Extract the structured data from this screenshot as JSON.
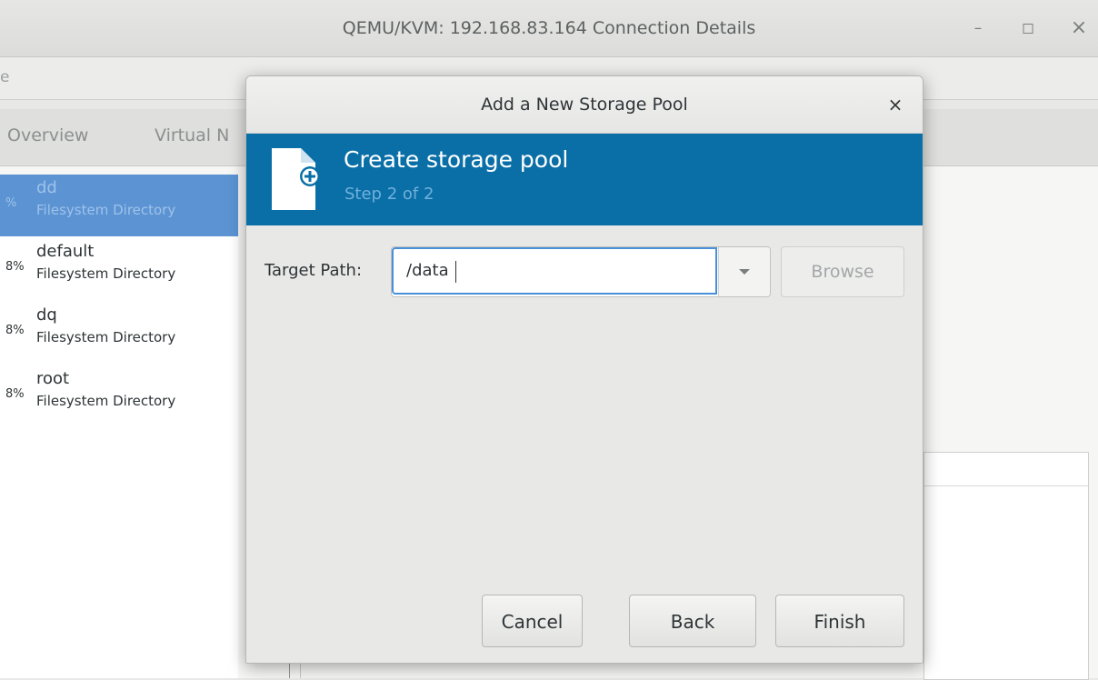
{
  "window": {
    "title": "QEMU/KVM: 192.168.83.164 Connection Details",
    "controls": {
      "minimize": "–",
      "maximize": "◻",
      "close": "×"
    }
  },
  "menubar": {
    "partial_item": "e"
  },
  "tabs": [
    {
      "label": "Overview"
    },
    {
      "label": "Virtual N"
    }
  ],
  "pools": [
    {
      "percent": "%",
      "name": "dd",
      "type": "Filesystem Directory",
      "selected": true
    },
    {
      "percent": "8%",
      "name": "default",
      "type": "Filesystem Directory",
      "selected": false
    },
    {
      "percent": "8%",
      "name": "dq",
      "type": "Filesystem Directory",
      "selected": false
    },
    {
      "percent": "8%",
      "name": "root",
      "type": "Filesystem Directory",
      "selected": false
    }
  ],
  "dialog": {
    "title": "Add a New Storage Pool",
    "close_label": "×",
    "banner": {
      "title": "Create storage pool",
      "step": "Step 2 of 2",
      "icon": "document-add-icon"
    },
    "target_path": {
      "label": "Target Path:",
      "value": "/data",
      "browse_label": "Browse",
      "browse_enabled": false
    },
    "buttons": {
      "cancel": "Cancel",
      "back": "Back",
      "finish": "Finish"
    }
  },
  "colors": {
    "banner": "#0b6fa7",
    "selection": "#5b93d3",
    "focus": "#4a90d9"
  }
}
